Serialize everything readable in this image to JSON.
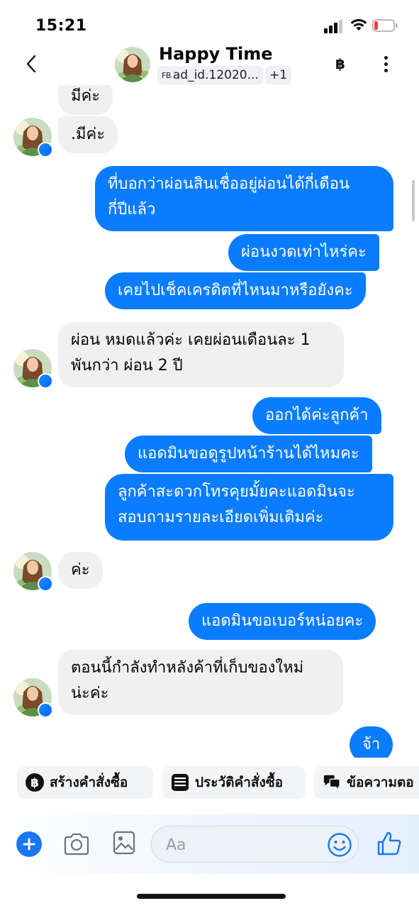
{
  "status_bar": {
    "time": "15:21"
  },
  "header": {
    "contact_name": "Happy Time",
    "ad_label_prefix": "FB",
    "ad_id": "ad_id.12020...",
    "extra_count": "+1",
    "currency_icon": "฿"
  },
  "messages": [
    {
      "side": "in",
      "text": "มีค่ะ"
    },
    {
      "side": "in",
      "text": ".มีค่ะ"
    },
    {
      "side": "out",
      "lines": [
        "ที่บอกว่าผ่อนสินเชื่ออยู่ผ่อนได้กี่เดือน",
        "กี่ปีแล้ว"
      ]
    },
    {
      "side": "out",
      "text": "ผ่อนงวดเท่าไหร่คะ"
    },
    {
      "side": "out",
      "text": "เคยไปเช็คเครดิตที่ไหนมาหรือยังคะ"
    },
    {
      "side": "in",
      "lines": [
        "ผ่อน หมดแล้วค่ะ เคยผ่อนเดือนละ 1",
        "พันกว่า ผ่อน 2 ปี"
      ]
    },
    {
      "side": "out",
      "text": "ออกได้ค่ะลูกค้า"
    },
    {
      "side": "out",
      "text": "แอดมินขอดูรูปหน้าร้านได้ไหมคะ"
    },
    {
      "side": "out",
      "lines": [
        "ลูกค้าสะดวกโทรคุยมั้ยคะแอดมินจะ",
        "สอบถามรายละเอียดเพิ่มเติมค่ะ"
      ]
    },
    {
      "side": "in",
      "text": "ค่ะ"
    },
    {
      "side": "out",
      "text": "แอดมินขอเบอร์หน่อยคะ"
    },
    {
      "side": "in",
      "lines": [
        "ตอนนี้กำลังทำหลังค้าที่เก็บของใหม่",
        "น่ะค่ะ"
      ]
    },
    {
      "side": "out",
      "text": "จ้า"
    }
  ],
  "quick_actions": [
    {
      "label": "สร้างคำสั่งซื้อ",
      "icon": "baht-circle-icon"
    },
    {
      "label": "ประวัติคำสั่งซื้อ",
      "icon": "order-list-icon"
    },
    {
      "label": "ข้อความตอ",
      "icon": "chat-bubbles-icon"
    }
  ],
  "composer": {
    "placeholder": "Aa"
  },
  "colors": {
    "outgoing": "#0a7cff",
    "incoming": "#f0f0f0",
    "accent": "#1877f2"
  }
}
